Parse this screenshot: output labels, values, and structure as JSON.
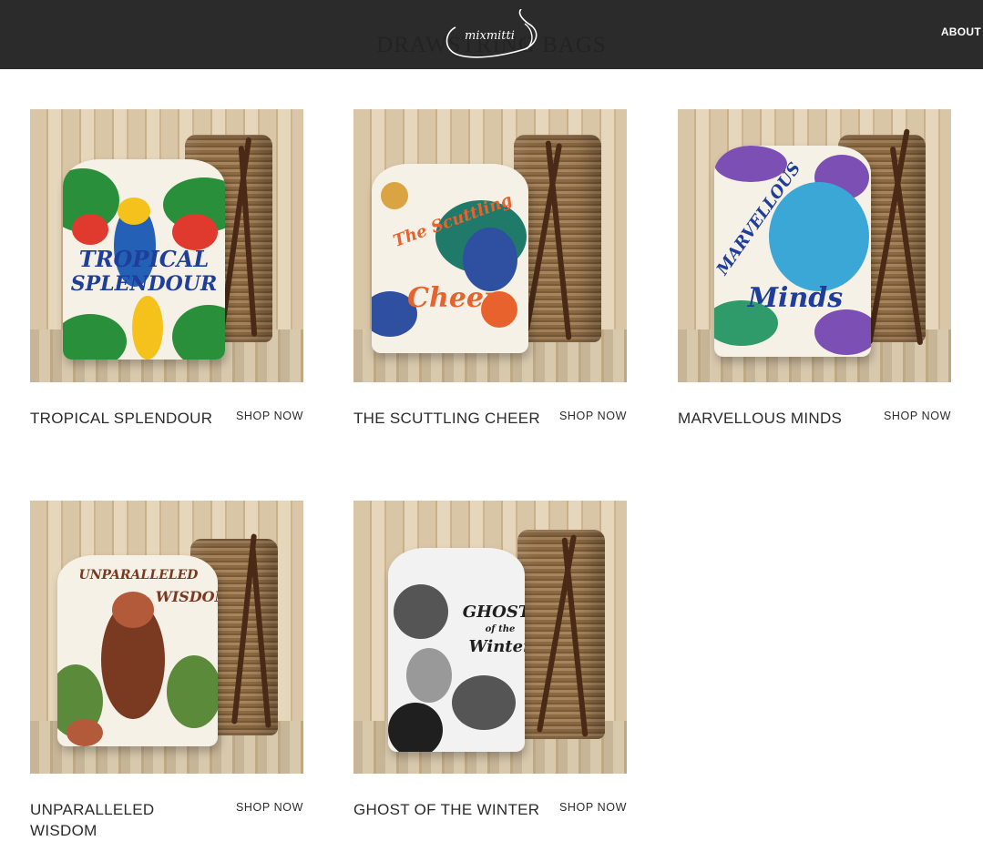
{
  "header": {
    "logo_text": "mixmitti",
    "page_title": "DRAWSTRING BAGS",
    "nav": {
      "about_label": "ABOUT"
    },
    "background_color": "#2b2b2b"
  },
  "products": [
    {
      "title": "TROPICAL SPLENDOUR",
      "cta": "SHOP NOW",
      "image_text": [
        "TROPICAL",
        "SPLENDOUR"
      ],
      "palette": [
        "#2a8f3a",
        "#e03a2f",
        "#f4c21b",
        "#2460b5"
      ]
    },
    {
      "title": "THE SCUTTLING CHEER",
      "cta": "SHOP NOW",
      "image_text": [
        "The Scuttling",
        "Cheer"
      ],
      "palette": [
        "#1f7a6a",
        "#e8622e",
        "#2f4fa0",
        "#d9a441"
      ]
    },
    {
      "title": "MARVELLOUS MINDS",
      "cta": "SHOP NOW",
      "image_text": [
        "MARVELLOUS",
        "Minds"
      ],
      "palette": [
        "#3aa7d6",
        "#7b4fb3",
        "#1f3e9a",
        "#2f9a6a"
      ]
    },
    {
      "title": "UNPARALLELED WISDOM",
      "cta": "SHOP NOW",
      "image_text": [
        "UNPARALLELED",
        "WISDOM"
      ],
      "palette": [
        "#7a3a22",
        "#5a8a3a",
        "#b35a3a",
        "#d9a441"
      ]
    },
    {
      "title": "GHOST OF THE WINTER",
      "cta": "SHOP NOW",
      "image_text": [
        "GHOST",
        "of the",
        "Winter"
      ],
      "palette": [
        "#1f1f1f",
        "#555555",
        "#999999",
        "#ffffff"
      ]
    }
  ]
}
